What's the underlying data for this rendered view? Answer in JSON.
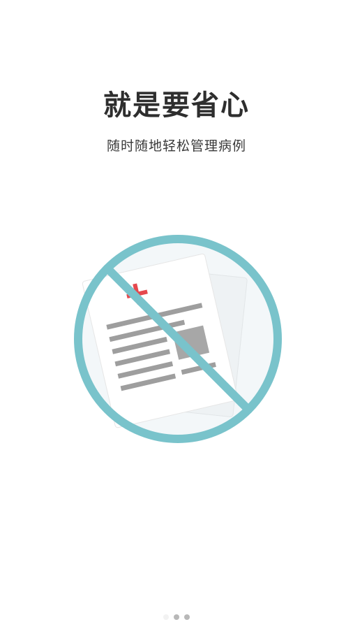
{
  "onboarding": {
    "title": "就是要省心",
    "subtitle": "随时随地轻松管理病例"
  },
  "illustration": {
    "icon": "no-paper-records-icon",
    "colors": {
      "ring": "#79c3cb",
      "cross": "#e5484d",
      "paper": "#ffffff",
      "lines": "#9e9e9e"
    }
  },
  "pager": {
    "count": 3,
    "active_index": 0
  }
}
